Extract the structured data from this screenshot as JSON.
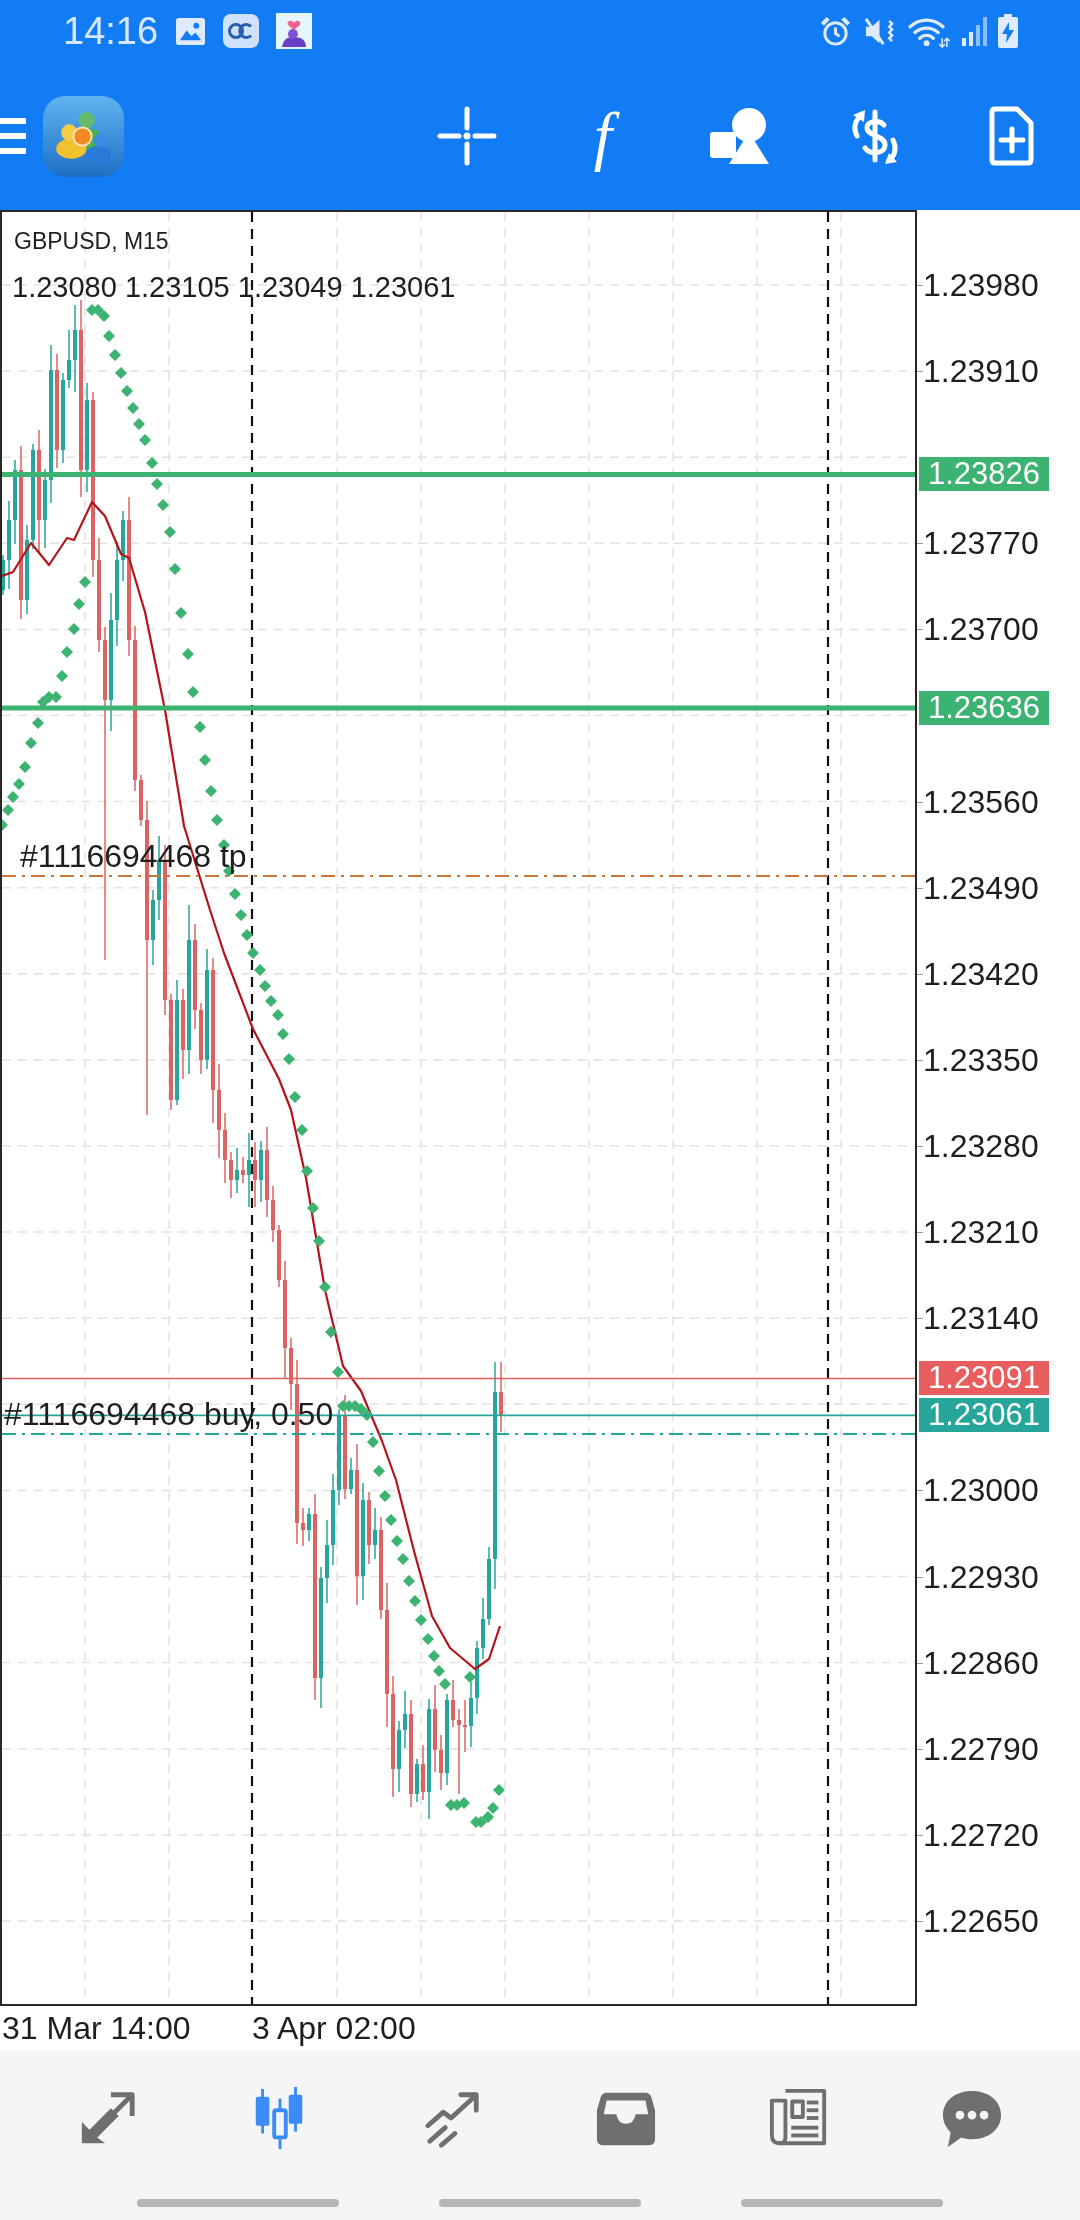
{
  "status_bar": {
    "time": "14:16"
  },
  "toolbar": {
    "glyph_button": "f"
  },
  "chart": {
    "symbol": "GBPUSD, M15",
    "ohlc": "1.23080 1.23105 1.23049 1.23061",
    "orders": [
      {
        "kind": "tp",
        "label": "#1116694468 tp"
      },
      {
        "kind": "buy",
        "label": "#1116694468 buy, 0.50"
      }
    ],
    "price_tags": [
      {
        "kind": "level",
        "price": "1.23826",
        "color": "#3cb371"
      },
      {
        "kind": "level",
        "price": "1.23636",
        "color": "#3cb371"
      },
      {
        "kind": "quote",
        "price": "1.23091",
        "color": "#e85d5d"
      },
      {
        "kind": "quote",
        "price": "1.23061",
        "color": "#26a69a"
      }
    ],
    "price_axis": [
      "1.23980",
      "1.23910",
      "1.23770",
      "1.23700",
      "1.23560",
      "1.23490",
      "1.23420",
      "1.23350",
      "1.23280",
      "1.23210",
      "1.23140",
      "1.23000",
      "1.22930",
      "1.22860",
      "1.22790",
      "1.22720",
      "1.22650"
    ],
    "time_axis": [
      "31 Mar 14:00",
      "3 Apr 02:00"
    ]
  },
  "bottom_nav": [
    {
      "kind": "arrows",
      "selected": false
    },
    {
      "kind": "candles",
      "selected": true
    },
    {
      "kind": "trend",
      "selected": false
    },
    {
      "kind": "inbox",
      "selected": false
    },
    {
      "kind": "newspaper",
      "selected": false
    },
    {
      "kind": "speech",
      "selected": false
    }
  ]
}
